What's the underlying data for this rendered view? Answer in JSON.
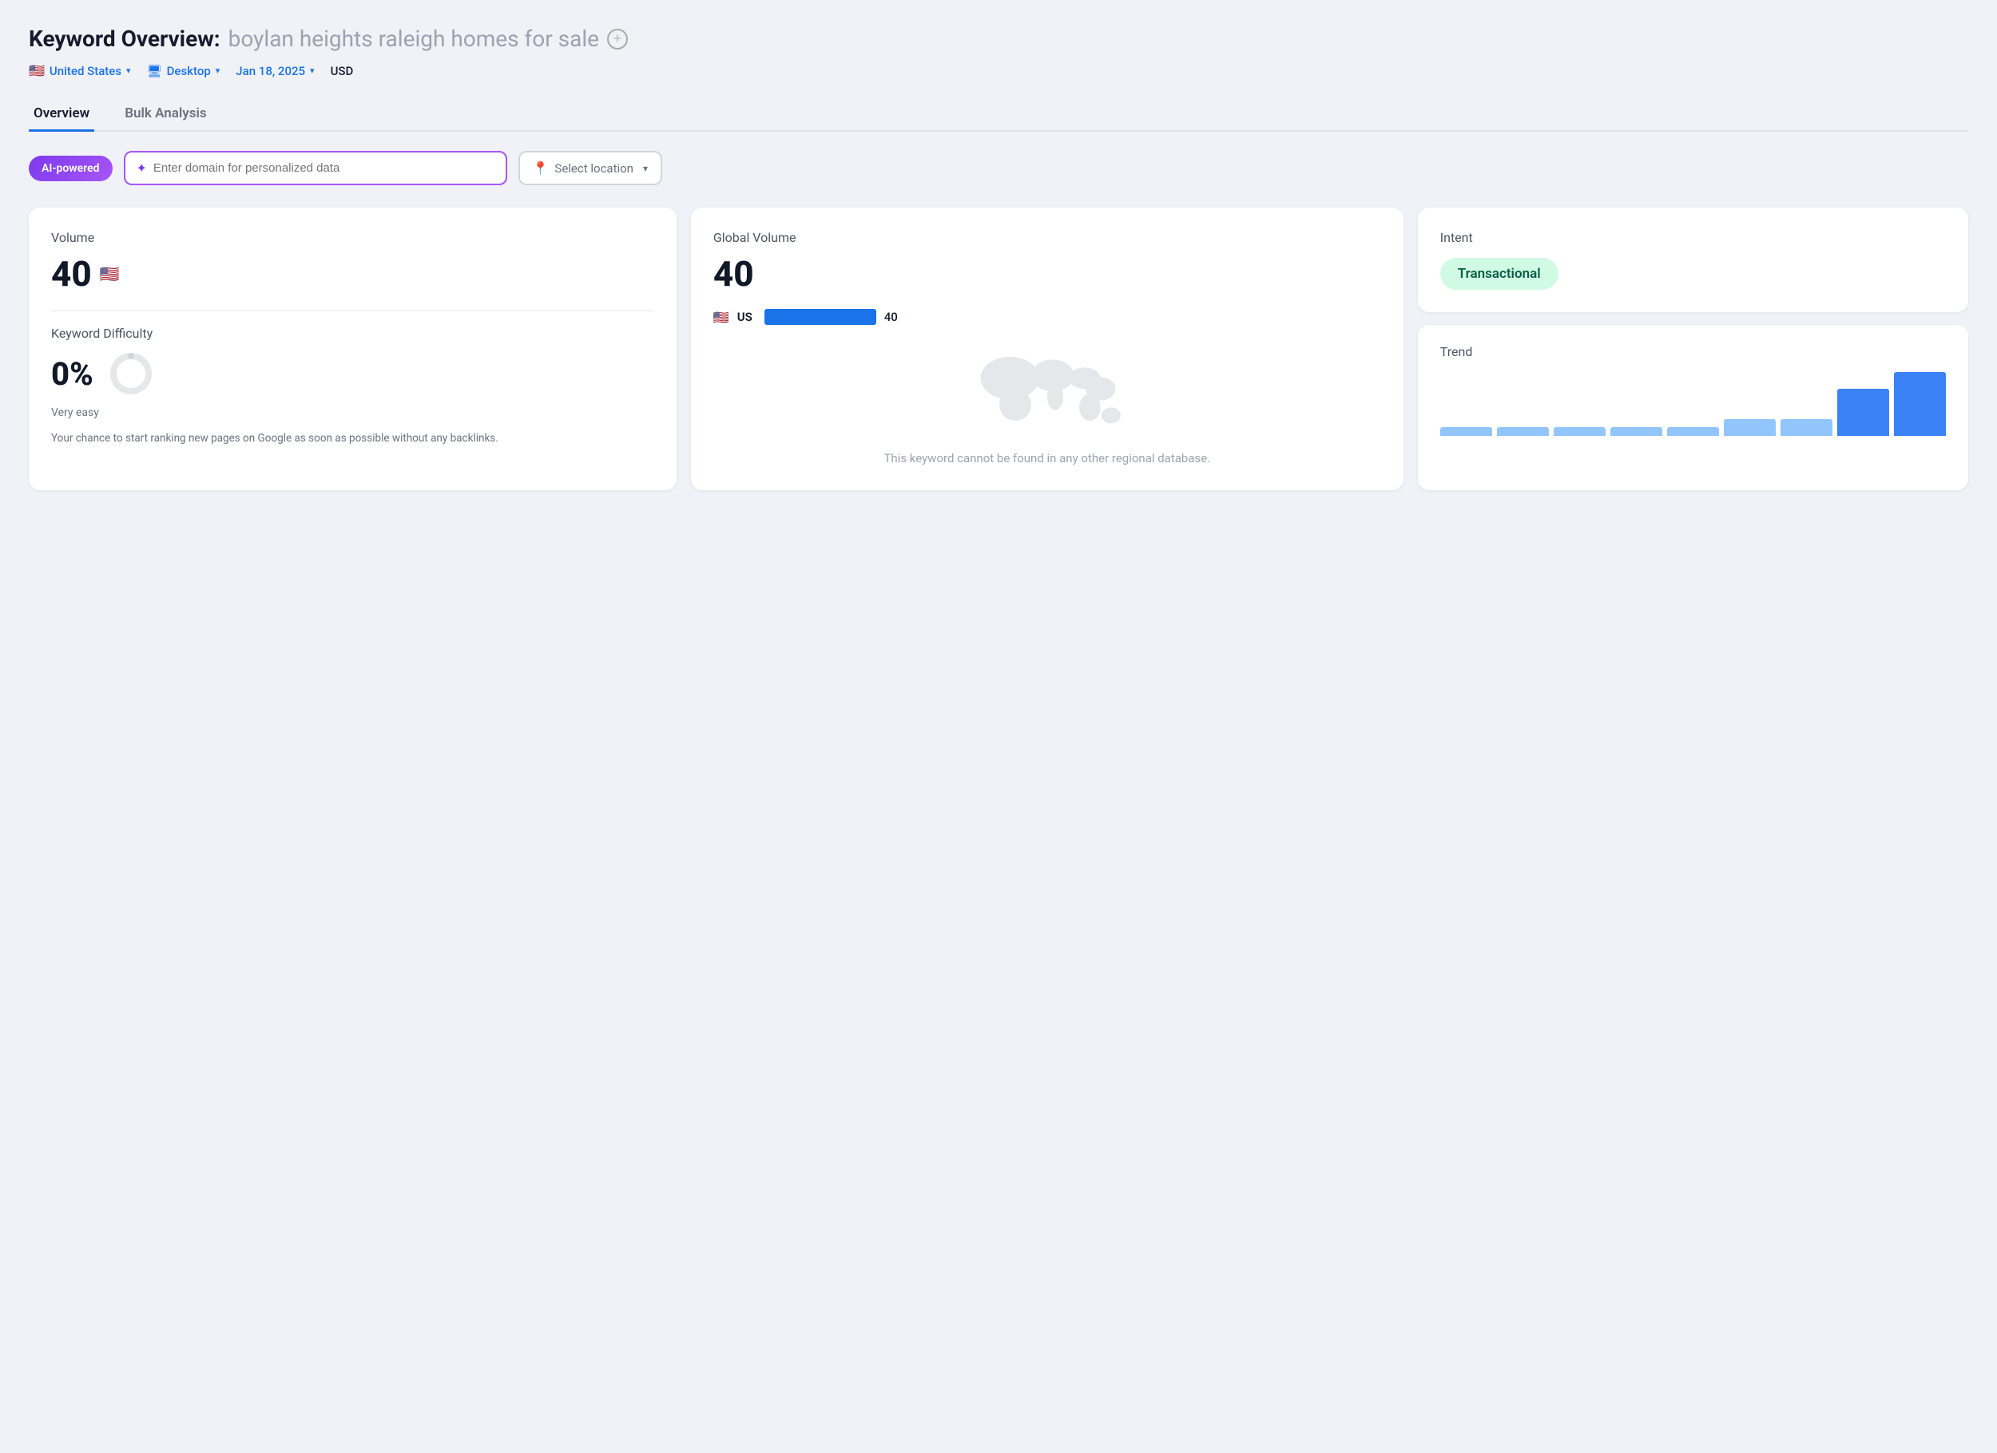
{
  "header": {
    "title_prefix": "Keyword Overview:",
    "keyword": "boylan heights raleigh homes for sale",
    "add_icon": "+"
  },
  "filters": {
    "country": "United States",
    "country_flag": "🇺🇸",
    "device": "Desktop",
    "date": "Jan 18, 2025",
    "currency": "USD"
  },
  "tabs": [
    {
      "label": "Overview",
      "active": true
    },
    {
      "label": "Bulk Analysis",
      "active": false
    }
  ],
  "search_bar": {
    "ai_badge_label": "AI-powered",
    "domain_placeholder": "Enter domain for personalized data",
    "sparkle_icon": "✦",
    "location_placeholder": "Select location",
    "chevron": "▾"
  },
  "cards": {
    "volume": {
      "label": "Volume",
      "value": "40",
      "flag": "🇺🇸"
    },
    "keyword_difficulty": {
      "label": "Keyword Difficulty",
      "percent": "0%",
      "difficulty_label": "Very easy",
      "description": "Your chance to start ranking new pages on Google as soon as possible without any backlinks."
    },
    "global_volume": {
      "label": "Global Volume",
      "value": "40",
      "country_flag": "🇺🇸",
      "country_code": "US",
      "bar_value": "40",
      "no_data_text": "This keyword cannot be found in any other regional database."
    },
    "intent": {
      "label": "Intent",
      "badge_label": "Transactional",
      "badge_color": "#d1fae5",
      "badge_text_color": "#065f46"
    },
    "trend": {
      "label": "Trend",
      "bars": [
        10,
        10,
        10,
        10,
        10,
        20,
        20,
        55,
        75
      ]
    }
  }
}
